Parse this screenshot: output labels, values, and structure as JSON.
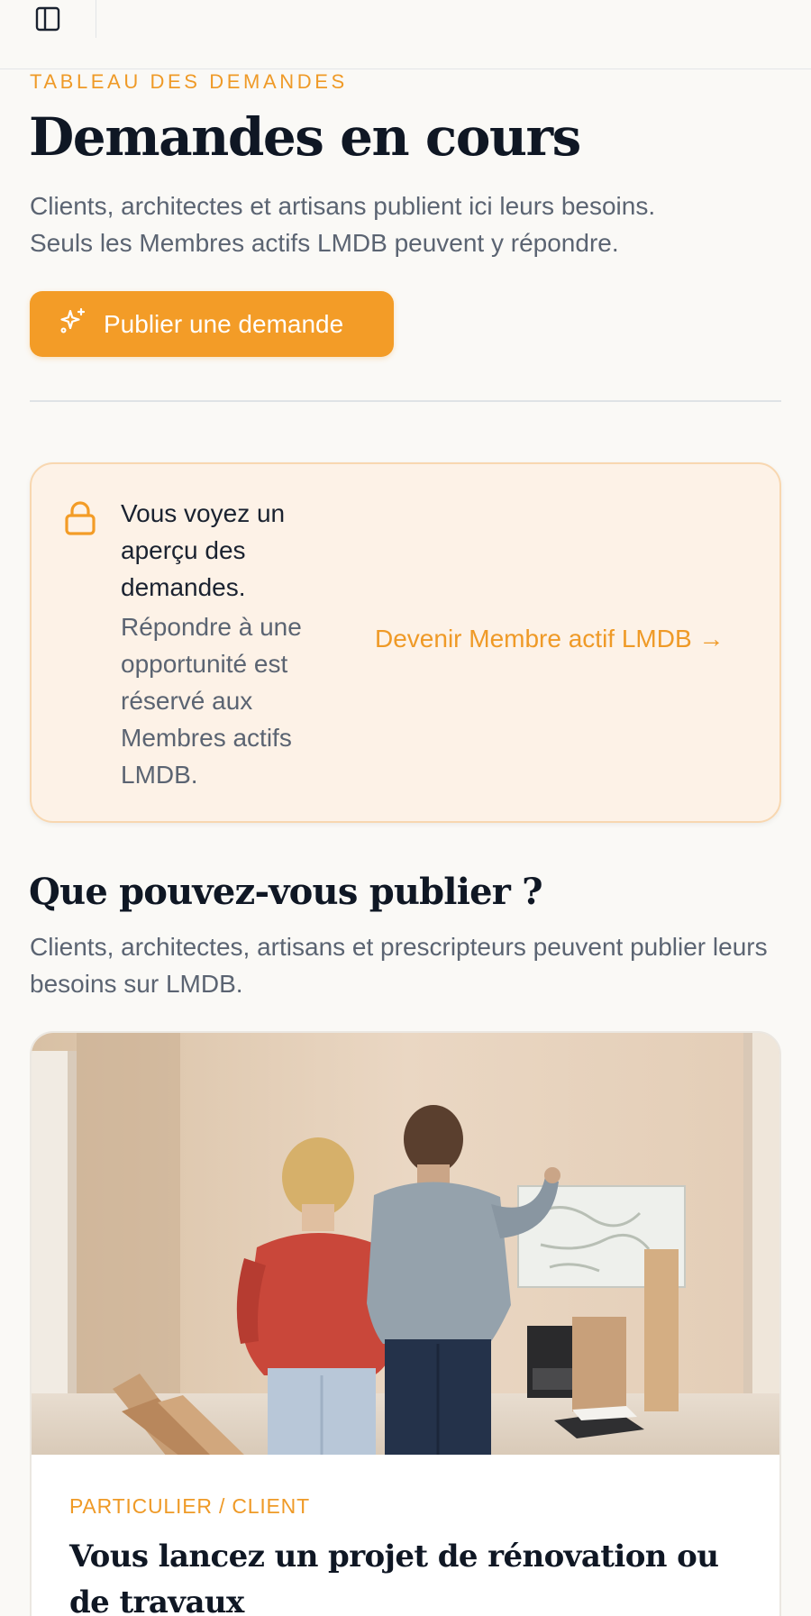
{
  "topbar": {
    "toggle_icon": "sidebar-toggle-icon"
  },
  "header": {
    "eyebrow": "TABLEAU DES DEMANDES",
    "title": "Demandes en cours",
    "lead_line1": "Clients, architectes et artisans publient ici leurs besoins.",
    "lead_line2": "Seuls les Membres actifs LMDB peuvent y répondre.",
    "publish_button": {
      "label": "Publier une demande",
      "icon": "sparkles-icon"
    }
  },
  "notice": {
    "icon": "lock-icon",
    "title": "Vous voyez un aperçu des demandes.",
    "text": "Répondre à une opportunité est réservé aux Membres actifs LMDB.",
    "link_label": "Devenir Membre actif LMDB →"
  },
  "publish_section": {
    "title": "Que pouvez-vous publier ?",
    "subtitle": "Clients, architectes, artisans et prescripteurs peuvent publier leurs besoins sur LMDB."
  },
  "cards": [
    {
      "image": "couple-renovation-photo",
      "tag": "PARTICULIER / CLIENT",
      "title": "Vous lancez un projet de rénovation ou de travaux"
    }
  ],
  "colors": {
    "accent": "#f39c27",
    "accent_text": "#ef9a27",
    "background": "#faf9f6",
    "notice_bg": "#fdf2e7",
    "heading": "#0f1724",
    "muted": "#5b6472"
  }
}
